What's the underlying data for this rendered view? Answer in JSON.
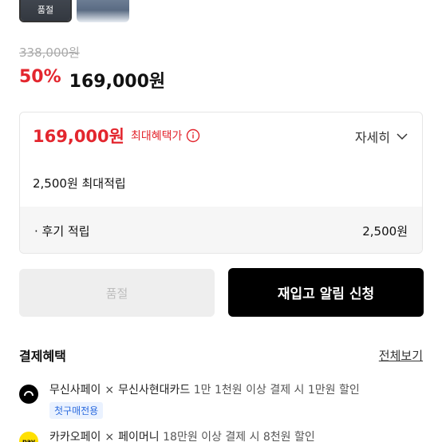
{
  "thumbnails": {
    "soldout_label": "품절"
  },
  "price": {
    "original": "338,000원",
    "discount": "50%",
    "sale": "169,000원"
  },
  "benefit": {
    "max_price": "169,000원",
    "max_label": "최대혜택가",
    "detail_label": "자세히",
    "points_label": "2,500원 최대적립",
    "review_label": "· 후기 적립",
    "review_value": "2,500원"
  },
  "buttons": {
    "soldout": "품절",
    "restock": "재입고 알림 신청"
  },
  "payment": {
    "title": "결제혜택",
    "view_all": "전체보기",
    "rows": [
      {
        "name1": "무신사페이",
        "sep": "×",
        "name2": "무신사현대카드",
        "desc": "1만 1천원 이상 결제 시 1만원 할인",
        "tag": "첫구매전용",
        "logo": "musinsa-pay-logo"
      },
      {
        "name1": "카카오페이",
        "sep": "×",
        "name2": "페이머니",
        "desc": "18만원 이상 결제 시 8천원 할인",
        "logo": "kakao-pay-logo"
      }
    ]
  },
  "colors": {
    "accent": "#e3262e",
    "tag_bg": "#eaf2ff",
    "tag_text": "#2d6cdf",
    "kakao": "#ffe000"
  }
}
